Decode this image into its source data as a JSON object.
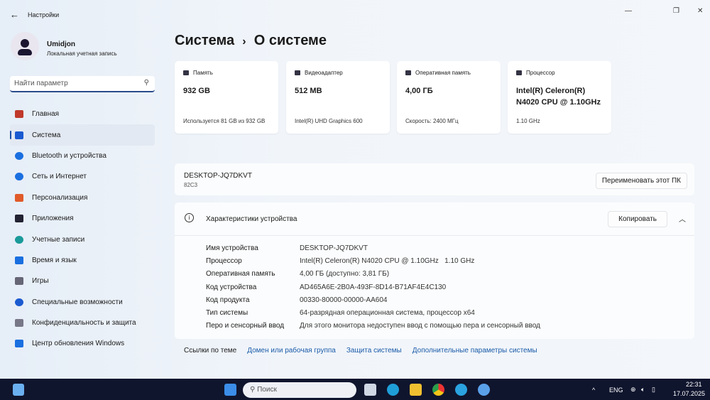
{
  "window": {
    "title": "Настройки",
    "back_icon": "arrow-left-icon"
  },
  "user": {
    "name": "Umidjon",
    "account_type": "Локальная учетная запись"
  },
  "search": {
    "placeholder": "Найти параметр"
  },
  "sidebar": {
    "items": [
      {
        "label": "Главная",
        "icon": "home-icon",
        "color": "#c0392b"
      },
      {
        "label": "Система",
        "icon": "monitor-icon",
        "color": "#1a5ad0"
      },
      {
        "label": "Bluetooth и устройства",
        "icon": "bluetooth-icon",
        "color": "#1a6fe0"
      },
      {
        "label": "Сеть и Интернет",
        "icon": "wifi-icon",
        "color": "#1a6fe0"
      },
      {
        "label": "Персонализация",
        "icon": "brush-icon",
        "color": "#e05a2a"
      },
      {
        "label": "Приложения",
        "icon": "apps-icon",
        "color": "#223"
      },
      {
        "label": "Учетные записи",
        "icon": "person-icon",
        "color": "#1a9a9a"
      },
      {
        "label": "Время и язык",
        "icon": "clock-globe-icon",
        "color": "#1a6fe0"
      },
      {
        "label": "Игры",
        "icon": "gamepad-icon",
        "color": "#667"
      },
      {
        "label": "Специальные возможности",
        "icon": "accessibility-icon",
        "color": "#1a5ad0"
      },
      {
        "label": "Конфиденциальность и защита",
        "icon": "shield-icon",
        "color": "#778"
      },
      {
        "label": "Центр обновления Windows",
        "icon": "update-icon",
        "color": "#1a6fe0"
      }
    ]
  },
  "breadcrumb": {
    "parent": "Система",
    "sep": "›",
    "current": "О системе"
  },
  "cards": [
    {
      "title": "Память",
      "value": "932 GB",
      "sub": "Используется 81 GB из 932 GB"
    },
    {
      "title": "Видеоадаптер",
      "value": "512 MB",
      "sub": "Intel(R) UHD Graphics 600"
    },
    {
      "title": "Оперативная память",
      "value": "4,00 ГБ",
      "sub": "Скорость: 2400 МГц"
    },
    {
      "title": "Процессор",
      "value": "Intel(R) Celeron(R) N4020 CPU @ 1.10GHz",
      "sub": "1.10 GHz"
    }
  ],
  "device": {
    "name": "DESKTOP-JQ7DKVT",
    "model": "82C3",
    "rename_label": "Переименовать этот ПК"
  },
  "specs": {
    "title": "Характеристики устройства",
    "copy_label": "Копировать",
    "rows": [
      {
        "k": "Имя устройства",
        "v": "DESKTOP-JQ7DKVT"
      },
      {
        "k": "Процессор",
        "v": "Intel(R) Celeron(R) N4020 CPU @ 1.10GHz   1.10 GHz"
      },
      {
        "k": "Оперативная память",
        "v": "4,00 ГБ (доступно: 3,81 ГБ)"
      },
      {
        "k": "Код устройства",
        "v": "AD465A6E-2B0A-493F-8D14-B71AF4E4C130"
      },
      {
        "k": "Код продукта",
        "v": "00330-80000-00000-AA604"
      },
      {
        "k": "Тип системы",
        "v": "64-разрядная операционная система, процессор x64"
      },
      {
        "k": "Перо и сенсорный ввод",
        "v": "Для этого монитора недоступен ввод с помощью пера и сенсорный ввод"
      }
    ]
  },
  "links": {
    "label": "Ссылки по теме",
    "items": [
      "Домен или рабочая группа",
      "Защита системы",
      "Дополнительные параметры системы"
    ]
  },
  "taskbar": {
    "search_placeholder": "Поиск",
    "lang": "ENG",
    "time": "22:31",
    "date": "17.07.2025"
  }
}
